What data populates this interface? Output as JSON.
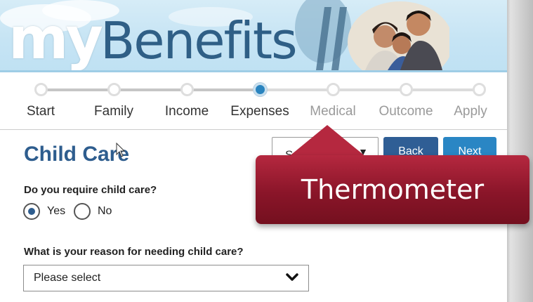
{
  "header": {
    "logo_my": "my",
    "logo_benefits": "Benefits"
  },
  "stepper": {
    "steps": [
      {
        "label": "Start",
        "state": "done"
      },
      {
        "label": "Family",
        "state": "done"
      },
      {
        "label": "Income",
        "state": "done"
      },
      {
        "label": "Expenses",
        "state": "current"
      },
      {
        "label": "Medical",
        "state": "future"
      },
      {
        "label": "Outcome",
        "state": "future"
      },
      {
        "label": "Apply",
        "state": "future"
      }
    ]
  },
  "page": {
    "title": "Child Care"
  },
  "toolbar": {
    "screen_select_text": "Scr",
    "back_label": "Back",
    "next_label": "Next"
  },
  "callout": {
    "text": "Thermometer",
    "color": "#8a1529"
  },
  "questions": {
    "q1_label": "Do you require child care?",
    "q1_options": [
      {
        "label": "Yes",
        "selected": true
      },
      {
        "label": "No",
        "selected": false
      }
    ],
    "q2_label": "What is your reason for needing child care?",
    "q2_value": "Please select"
  },
  "colors": {
    "accent": "#2a84bf",
    "title": "#2e5d8e",
    "back_button": "#2f5e95",
    "next_button": "#2a86c4"
  },
  "icons": [
    "cursor-arrow-icon",
    "chevron-down-icon"
  ]
}
